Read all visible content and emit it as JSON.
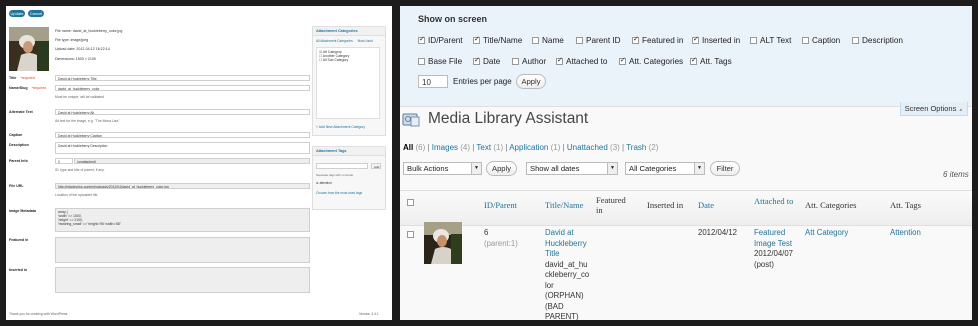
{
  "edit_page": {
    "update_label": "Update",
    "cancel_label": "Cancel",
    "meta": {
      "file_name": "File name: david_at_huckleberry_color.jpg",
      "file_type": "File type: image/jpeg",
      "upload_date": "Upload date: 2012-04-12 16:22:14",
      "dimensions": "Dimensions: 1500 × 2100"
    },
    "title_label": "Title",
    "required_label": "*required",
    "title_value": "David at Huckleberry Title",
    "slug_label": "Name/Slug",
    "slug_value": "david_at_huckleberry_color",
    "slug_hint": "Must be unique; will be validated",
    "alt_label": "Alternate Text",
    "alt_value": "David at Huckleberry Alt",
    "alt_hint": "Alt text for the image, e.g. \"The Mona Lisa\"",
    "caption_label": "Caption",
    "caption_value": "David at Huckleberry Caption",
    "description_label": "Description",
    "description_value": "David at Huckleberry Description",
    "parent_label": "Parent Info",
    "parent_value": "0",
    "parent_status": "(unattached)",
    "parent_hint": "ID, type and title of parent, if any.",
    "file_url_label": "File URL",
    "file_url_value": "http://mladev/wp-content/uploads/2012/04/david_at_huckleberry_color.jpg",
    "file_url_hint": "Location of the uploaded file.",
    "image_metadata_label": "Image Metadata",
    "image_metadata_lines": [
      "array (",
      "  'width' => 1500,",
      "  'height' => 2100,",
      "  'hwstring_small' => 'height='96' width='68''"
    ],
    "featured_label": "Featured in",
    "inserted_label": "Inserted in",
    "footer_thanks": "Thank you for creating with WordPress.",
    "footer_version": "Version 3.4.1",
    "categories_box": {
      "title": "Attachment Categories",
      "tab_all": "All Attachment Categories",
      "tab_used": "Most Used",
      "items": [
        "Att Category",
        "Another Category",
        "All Sub Category"
      ],
      "add_link": "+ Add New Attachment Category"
    },
    "tags_box": {
      "title": "Attachment Tags",
      "add_label": "Add",
      "hint": "Separate tags with commas",
      "tag": "attention",
      "choose_link": "Choose from the most used tags"
    }
  },
  "screen_options": {
    "title": "Show on screen",
    "columns_row1": [
      {
        "label": "ID/Parent",
        "checked": true
      },
      {
        "label": "Title/Name",
        "checked": true
      },
      {
        "label": "Name",
        "checked": false
      },
      {
        "label": "Parent ID",
        "checked": false
      },
      {
        "label": "Featured in",
        "checked": true
      },
      {
        "label": "Inserted in",
        "checked": true
      },
      {
        "label": "ALT Text",
        "checked": false
      },
      {
        "label": "Caption",
        "checked": false
      },
      {
        "label": "Description",
        "checked": false
      }
    ],
    "columns_row2": [
      {
        "label": "Base File",
        "checked": false
      },
      {
        "label": "Date",
        "checked": true
      },
      {
        "label": "Author",
        "checked": false
      },
      {
        "label": "Attached to",
        "checked": true
      },
      {
        "label": "Att. Categories",
        "checked": true
      },
      {
        "label": "Att. Tags",
        "checked": true
      }
    ],
    "per_page_value": "10",
    "per_page_label": "Entries per page",
    "apply_label": "Apply",
    "tab_label": "Screen Options"
  },
  "library": {
    "title": "Media Library Assistant",
    "views": {
      "all": "All",
      "all_count": "(6)",
      "images": "Images",
      "images_count": "(4)",
      "text": "Text",
      "text_count": "(1)",
      "application": "Application",
      "application_count": "(1)",
      "unattached": "Unattached",
      "unattached_count": "(3)",
      "trash": "Trash",
      "trash_count": "(2)"
    },
    "bulk_actions": "Bulk Actions",
    "apply_label": "Apply",
    "dates": "Show all dates",
    "categories": "All Categories",
    "filter_label": "Filter",
    "items_count": "6 items",
    "columns": {
      "id_parent": "ID/Parent",
      "title_name": "Title/Name",
      "featured": "Featured in",
      "inserted": "Inserted in",
      "date": "Date",
      "attached": "Attached to",
      "att_categories": "Att. Categories",
      "att_tags": "Att. Tags"
    },
    "row": {
      "id": "6",
      "parent": "(parent:1)",
      "title_lines": [
        "David at",
        "Huckleberry",
        "Title",
        "david_at_hu",
        "ckleberry_co",
        "lor",
        "(ORPHAN)",
        "(BAD",
        "PARENT)"
      ],
      "date": "2012/04/12",
      "attached_lines": [
        "Featured",
        "Image Test",
        "2012/04/07",
        "(post)"
      ],
      "category": "Att Category",
      "tag": "Attention"
    }
  }
}
